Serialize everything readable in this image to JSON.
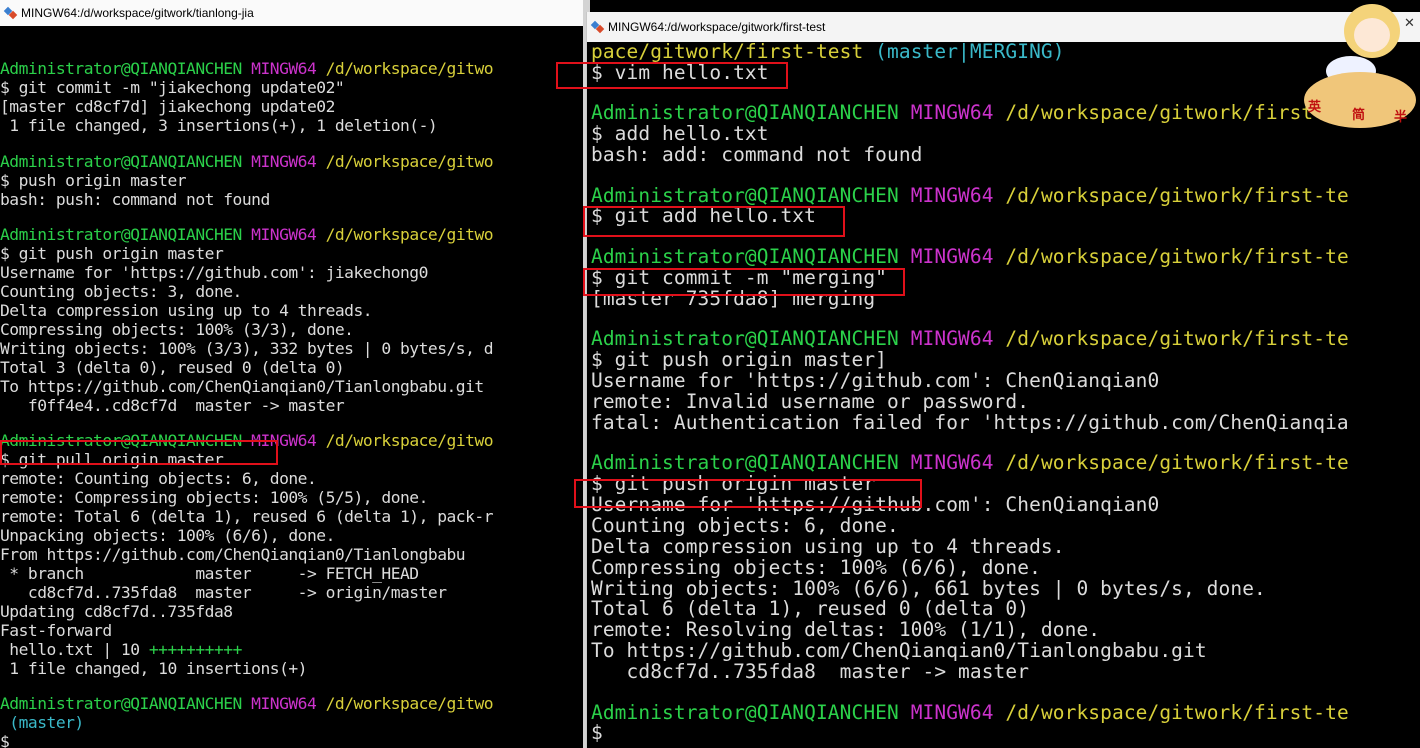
{
  "left_window": {
    "title": "MINGW64:/d/workspace/gitwork/tianlong-jia",
    "lines": [
      [
        {
          "t": ""
        }
      ],
      [
        {
          "t": "Administrator@QIANQIANCHEN",
          "c": "u"
        },
        {
          "t": " "
        },
        {
          "t": "MINGW64",
          "c": "m"
        },
        {
          "t": " "
        },
        {
          "t": "/d/workspace/gitwo",
          "c": "p"
        }
      ],
      [
        {
          "t": "$ git commit -m \"jiakechong update02\""
        }
      ],
      [
        {
          "t": "[master cd8cf7d] jiakechong update02"
        }
      ],
      [
        {
          "t": " 1 file changed, 3 insertions(+), 1 deletion(-)"
        }
      ],
      [
        {
          "t": ""
        }
      ],
      [
        {
          "t": "Administrator@QIANQIANCHEN",
          "c": "u"
        },
        {
          "t": " "
        },
        {
          "t": "MINGW64",
          "c": "m"
        },
        {
          "t": " "
        },
        {
          "t": "/d/workspace/gitwo",
          "c": "p"
        }
      ],
      [
        {
          "t": "$ push origin master"
        }
      ],
      [
        {
          "t": "bash: push: command not found"
        }
      ],
      [
        {
          "t": ""
        }
      ],
      [
        {
          "t": "Administrator@QIANQIANCHEN",
          "c": "u"
        },
        {
          "t": " "
        },
        {
          "t": "MINGW64",
          "c": "m"
        },
        {
          "t": " "
        },
        {
          "t": "/d/workspace/gitwo",
          "c": "p"
        }
      ],
      [
        {
          "t": "$ git push origin master"
        }
      ],
      [
        {
          "t": "Username for 'https://github.com': jiakechong0"
        }
      ],
      [
        {
          "t": "Counting objects: 3, done."
        }
      ],
      [
        {
          "t": "Delta compression using up to 4 threads."
        }
      ],
      [
        {
          "t": "Compressing objects: 100% (3/3), done."
        }
      ],
      [
        {
          "t": "Writing objects: 100% (3/3), 332 bytes | 0 bytes/s, d"
        }
      ],
      [
        {
          "t": "Total 3 (delta 0), reused 0 (delta 0)"
        }
      ],
      [
        {
          "t": "To https://github.com/ChenQianqian0/Tianlongbabu.git"
        }
      ],
      [
        {
          "t": "   f0ff4e4..cd8cf7d  master -> master"
        }
      ],
      [
        {
          "t": ""
        }
      ],
      [
        {
          "t": "Administrator@QIANQIANCHEN",
          "c": "u"
        },
        {
          "t": " "
        },
        {
          "t": "MINGW64",
          "c": "m"
        },
        {
          "t": " "
        },
        {
          "t": "/d/workspace/gitwo",
          "c": "p"
        }
      ],
      [
        {
          "t": "$ git pull origin master"
        }
      ],
      [
        {
          "t": "remote: Counting objects: 6, done."
        }
      ],
      [
        {
          "t": "remote: Compressing objects: 100% (5/5), done."
        }
      ],
      [
        {
          "t": "remote: Total 6 (delta 1), reused 6 (delta 1), pack-r"
        }
      ],
      [
        {
          "t": "Unpacking objects: 100% (6/6), done."
        }
      ],
      [
        {
          "t": "From https://github.com/ChenQianqian0/Tianlongbabu"
        }
      ],
      [
        {
          "t": " * branch            master     -> FETCH_HEAD"
        }
      ],
      [
        {
          "t": "   cd8cf7d..735fda8  master     -> origin/master"
        }
      ],
      [
        {
          "t": "Updating cd8cf7d..735fda8"
        }
      ],
      [
        {
          "t": "Fast-forward"
        }
      ],
      [
        {
          "t": " hello.txt | 10 "
        },
        {
          "t": "++++++++++",
          "c": "g"
        }
      ],
      [
        {
          "t": " 1 file changed, 10 insertions(+)"
        }
      ],
      [
        {
          "t": ""
        }
      ],
      [
        {
          "t": "Administrator@QIANQIANCHEN",
          "c": "u"
        },
        {
          "t": " "
        },
        {
          "t": "MINGW64",
          "c": "m"
        },
        {
          "t": " "
        },
        {
          "t": "/d/workspace/gitwo",
          "c": "p"
        }
      ],
      [
        {
          "t": " (master)",
          "c": "c"
        }
      ],
      [
        {
          "t": "$"
        }
      ]
    ]
  },
  "right_window": {
    "title": "MINGW64:/d/workspace/gitwork/first-test",
    "lines": [
      [
        {
          "t": "pace/gitwork/first-test",
          "c": "p"
        },
        {
          "t": " "
        },
        {
          "t": "(master|MERGING)",
          "c": "c"
        }
      ],
      [
        {
          "t": "$ vim hello.txt"
        }
      ],
      [
        {
          "t": ""
        }
      ],
      [
        {
          "t": "Administrator@QIANQIANCHEN",
          "c": "u"
        },
        {
          "t": " "
        },
        {
          "t": "MINGW64",
          "c": "m"
        },
        {
          "t": " "
        },
        {
          "t": "/d/workspace/gitwork/first-te",
          "c": "p"
        }
      ],
      [
        {
          "t": "$ add hello.txt"
        }
      ],
      [
        {
          "t": "bash: add: command not found"
        }
      ],
      [
        {
          "t": ""
        }
      ],
      [
        {
          "t": "Administrator@QIANQIANCHEN",
          "c": "u"
        },
        {
          "t": " "
        },
        {
          "t": "MINGW64",
          "c": "m"
        },
        {
          "t": " "
        },
        {
          "t": "/d/workspace/gitwork/first-te",
          "c": "p"
        }
      ],
      [
        {
          "t": "$ git add hello.txt"
        }
      ],
      [
        {
          "t": ""
        }
      ],
      [
        {
          "t": "Administrator@QIANQIANCHEN",
          "c": "u"
        },
        {
          "t": " "
        },
        {
          "t": "MINGW64",
          "c": "m"
        },
        {
          "t": " "
        },
        {
          "t": "/d/workspace/gitwork/first-te",
          "c": "p"
        }
      ],
      [
        {
          "t": "$ git commit -m \"merging\""
        }
      ],
      [
        {
          "t": "[master 735fda8] merging"
        }
      ],
      [
        {
          "t": ""
        }
      ],
      [
        {
          "t": "Administrator@QIANQIANCHEN",
          "c": "u"
        },
        {
          "t": " "
        },
        {
          "t": "MINGW64",
          "c": "m"
        },
        {
          "t": " "
        },
        {
          "t": "/d/workspace/gitwork/first-te",
          "c": "p"
        }
      ],
      [
        {
          "t": "$ git push origin master]"
        }
      ],
      [
        {
          "t": "Username for 'https://github.com': ChenQianqian0"
        }
      ],
      [
        {
          "t": "remote: Invalid username or password."
        }
      ],
      [
        {
          "t": "fatal: Authentication failed for 'https://github.com/ChenQianqia"
        }
      ],
      [
        {
          "t": ""
        }
      ],
      [
        {
          "t": "Administrator@QIANQIANCHEN",
          "c": "u"
        },
        {
          "t": " "
        },
        {
          "t": "MINGW64",
          "c": "m"
        },
        {
          "t": " "
        },
        {
          "t": "/d/workspace/gitwork/first-te",
          "c": "p"
        }
      ],
      [
        {
          "t": "$ git push origin master"
        }
      ],
      [
        {
          "t": "Username for 'https://github.com': ChenQianqian0"
        }
      ],
      [
        {
          "t": "Counting objects: 6, done."
        }
      ],
      [
        {
          "t": "Delta compression using up to 4 threads."
        }
      ],
      [
        {
          "t": "Compressing objects: 100% (6/6), done."
        }
      ],
      [
        {
          "t": "Writing objects: 100% (6/6), 661 bytes | 0 bytes/s, done."
        }
      ],
      [
        {
          "t": "Total 6 (delta 1), reused 0 (delta 0)"
        }
      ],
      [
        {
          "t": "remote: Resolving deltas: 100% (1/1), done."
        }
      ],
      [
        {
          "t": "To https://github.com/ChenQianqian0/Tianlongbabu.git"
        }
      ],
      [
        {
          "t": "   cd8cf7d..735fda8  master -> master"
        }
      ],
      [
        {
          "t": ""
        }
      ],
      [
        {
          "t": "Administrator@QIANQIANCHEN",
          "c": "u"
        },
        {
          "t": " "
        },
        {
          "t": "MINGW64",
          "c": "m"
        },
        {
          "t": " "
        },
        {
          "t": "/d/workspace/gitwork/first-te",
          "c": "p"
        }
      ],
      [
        {
          "t": "$"
        }
      ]
    ]
  },
  "ime_widget": {
    "icon": "anime-girl-mascot-icon",
    "labels": [
      "英",
      "简",
      "半"
    ]
  },
  "colors": {
    "background": "#000000",
    "text": "#dcdcdc",
    "user_host": "#2bd14a",
    "mingw": "#cc33cc",
    "path": "#d8d03a",
    "branch": "#3ab9c9",
    "highlight_box": "#e0101a"
  }
}
